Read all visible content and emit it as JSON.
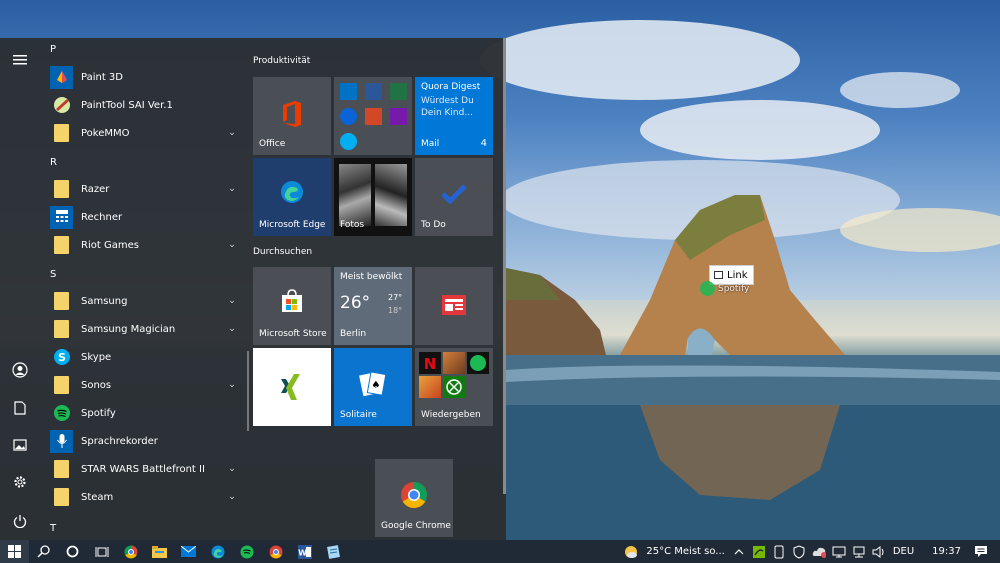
{
  "drag_tooltip": {
    "label": "Link",
    "app": "Spotify"
  },
  "start_menu": {
    "applist": [
      {
        "type": "letter",
        "label": "P"
      },
      {
        "type": "app",
        "label": "Paint 3D",
        "icon": "paint3d-icon",
        "expandable": false
      },
      {
        "type": "app",
        "label": "PaintTool SAI Ver.1",
        "icon": "painttool-sai-icon",
        "expandable": false
      },
      {
        "type": "app",
        "label": "PokeMMO",
        "icon": "folder-icon",
        "expandable": true
      },
      {
        "type": "letter",
        "label": "R"
      },
      {
        "type": "app",
        "label": "Razer",
        "icon": "folder-icon",
        "expandable": true
      },
      {
        "type": "app",
        "label": "Rechner",
        "icon": "calculator-icon",
        "expandable": false
      },
      {
        "type": "app",
        "label": "Riot Games",
        "icon": "folder-icon",
        "expandable": true
      },
      {
        "type": "letter",
        "label": "S"
      },
      {
        "type": "app",
        "label": "Samsung",
        "icon": "folder-icon",
        "expandable": true
      },
      {
        "type": "app",
        "label": "Samsung Magician",
        "icon": "folder-icon",
        "expandable": true
      },
      {
        "type": "app",
        "label": "Skype",
        "icon": "skype-icon",
        "expandable": false
      },
      {
        "type": "app",
        "label": "Sonos",
        "icon": "folder-icon",
        "expandable": true
      },
      {
        "type": "app",
        "label": "Spotify",
        "icon": "spotify-icon",
        "expandable": false
      },
      {
        "type": "app",
        "label": "Sprachrekorder",
        "icon": "microphone-icon",
        "expandable": false
      },
      {
        "type": "app",
        "label": "STAR WARS Battlefront II",
        "icon": "folder-icon",
        "expandable": true
      },
      {
        "type": "app",
        "label": "Steam",
        "icon": "folder-icon",
        "expandable": true
      },
      {
        "type": "letter",
        "label": "T"
      }
    ],
    "groups": {
      "productivity": "Produktivität",
      "browse": "Durchsuchen"
    },
    "tiles": {
      "office": "Office",
      "mail": "Mail",
      "mail_count": "4",
      "quora_title": "Quora Digest",
      "quora_body": "Würdest Du Dein Kind...",
      "edge": "Microsoft Edge",
      "photos": "Fotos",
      "todo": "To Do",
      "store": "Microsoft Store",
      "weather_title": "Meist bewölkt",
      "weather_temp": "26°",
      "weather_high": "27°",
      "weather_low": "18°",
      "weather_city": "Berlin",
      "solitaire": "Solitaire",
      "play": "Wiedergeben",
      "chrome": "Google Chrome"
    }
  },
  "taskbar": {
    "weather": "25°C  Meist so...",
    "language": "DEU",
    "time": "19:37"
  },
  "colors": {
    "accent": "#0078d7",
    "taskbar": "#1f2a36",
    "start_bg": "#2b2f34"
  }
}
